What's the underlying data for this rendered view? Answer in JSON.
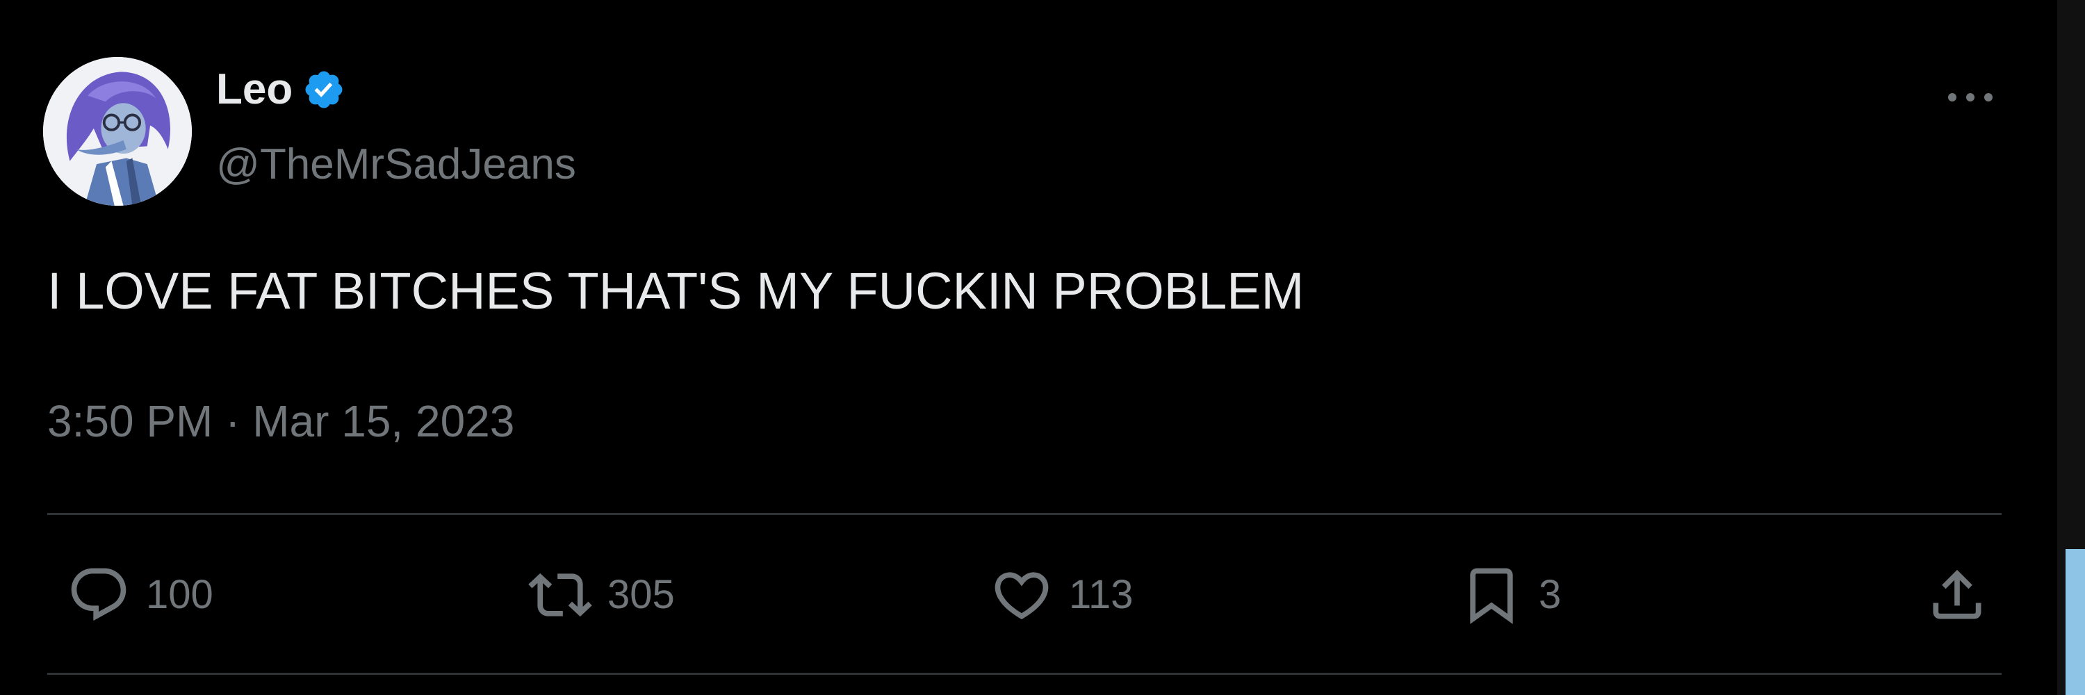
{
  "author": {
    "display_name": "Leo",
    "handle": "@TheMrSadJeans",
    "verified": true,
    "verified_color": "#1d9bf0"
  },
  "tweet": {
    "text": "I LOVE FAT BITCHES THAT'S MY FUCKIN PROBLEM",
    "timestamp": "3:50 PM · Mar 15, 2023"
  },
  "actions": {
    "reply_count": "100",
    "retweet_count": "305",
    "like_count": "113",
    "bookmark_count": "3"
  },
  "icons": {
    "more": "more-horizontal-icon",
    "reply": "reply-icon",
    "retweet": "retweet-icon",
    "like": "heart-icon",
    "bookmark": "bookmark-icon",
    "share": "share-icon"
  },
  "colors": {
    "background": "#000000",
    "primary_text": "#e7e9ea",
    "secondary_text": "#71767b",
    "divider": "#2f3336",
    "scrollbar_thumb": "#8ec5e6"
  }
}
